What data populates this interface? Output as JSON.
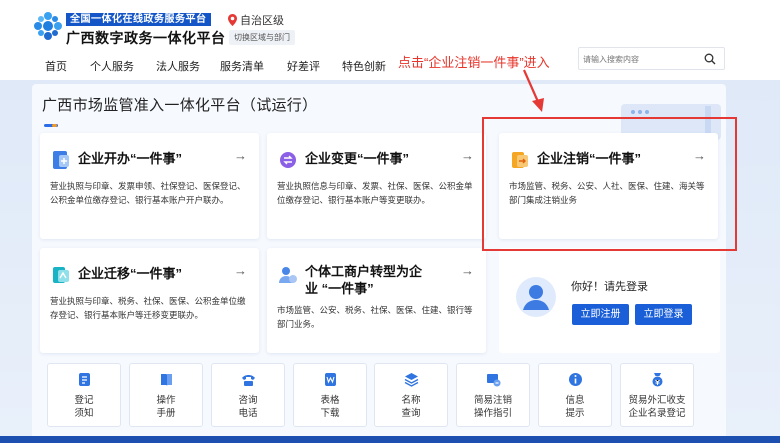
{
  "brand": {
    "top_line": "全国一体化在线政务服务平台",
    "main_title": "广西数字政务一体化平台",
    "region": "自治区级",
    "switch_label": "切换区域与部门"
  },
  "nav": {
    "items": [
      "首页",
      "个人服务",
      "法人服务",
      "服务清单",
      "好差评",
      "特色创新"
    ]
  },
  "annotation": "点击“企业注销一件事”进入",
  "search": {
    "placeholder": "请输入搜索内容"
  },
  "panel": {
    "title": "广西市场监管准入一体化平台（试运行）"
  },
  "cards": [
    {
      "title": "企业开办“一件事”",
      "desc": "营业执照与印章、发票申领、社保登记、医保登记、公积金单位缴存登记、银行基本账户开户联办。",
      "arrow": "→",
      "icon": "company-open-icon"
    },
    {
      "title": "企业变更“一件事”",
      "desc": "营业执照信息与印章、发票、社保、医保、公积金单位缴存登记、银行基本账户等变更联办。",
      "arrow": "→",
      "icon": "company-change-icon"
    },
    {
      "title": "企业注销“一件事”",
      "desc": "市场监管、税务、公安、人社、医保、住建、海关等部门集成注销业务",
      "arrow": "→",
      "icon": "company-cancel-icon"
    },
    {
      "title": "企业迁移“一件事”",
      "desc": "营业执照与印章、税务、社保、医保、公积金单位缴存登记、银行基本账户等迁移变更联办。",
      "arrow": "→",
      "icon": "company-migrate-icon"
    },
    {
      "title_line1": "个体工商户转型为企",
      "title_line2": "业 “一件事”",
      "desc": "市场监管、公安、税务、社保、医保、住建、银行等部门业务。",
      "arrow": "→",
      "icon": "individual-transform-icon"
    }
  ],
  "login": {
    "hello": "你好！请先登录",
    "register_label": "立即注册",
    "login_label": "立即登录"
  },
  "tools": [
    {
      "line1": "登记",
      "line2": "须知",
      "icon": "notice-icon"
    },
    {
      "line1": "操作",
      "line2": "手册",
      "icon": "manual-icon"
    },
    {
      "line1": "咨询",
      "line2": "电话",
      "icon": "phone-icon"
    },
    {
      "line1": "表格",
      "line2": "下载",
      "icon": "word-download-icon"
    },
    {
      "line1": "名称",
      "line2": "查询",
      "icon": "name-query-icon"
    },
    {
      "line1": "简易注销",
      "line2": "操作指引",
      "icon": "simple-cancel-icon"
    },
    {
      "line1": "信息",
      "line2": "提示",
      "icon": "info-icon"
    },
    {
      "line1": "贸易外汇收支",
      "line2": "企业名录登记",
      "icon": "forex-icon"
    }
  ],
  "colors": {
    "brand_blue": "#1456c7",
    "button_blue": "#1a5fd8",
    "highlight_red": "#e53935",
    "accent_orange": "#f59a23"
  }
}
